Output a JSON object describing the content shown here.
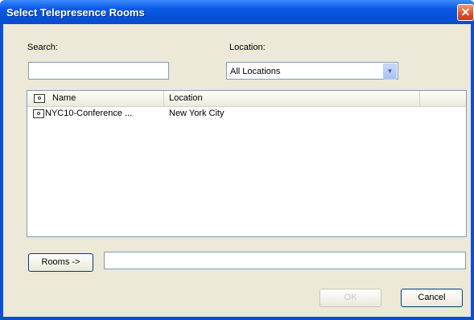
{
  "window": {
    "title": "Select Telepresence Rooms",
    "close_glyph": "✕"
  },
  "search": {
    "label": "Search:",
    "value": ""
  },
  "location": {
    "label": "Location:",
    "selected": "All Locations"
  },
  "table": {
    "headers": [
      "Name",
      "Location"
    ],
    "rows": [
      {
        "name": "NYC10-Conference ...",
        "location": "New York City",
        "icon": "telepresence-room-icon"
      }
    ]
  },
  "rooms": {
    "button_label": "Rooms ->",
    "value": ""
  },
  "footer": {
    "ok_label": "OK",
    "cancel_label": "Cancel"
  }
}
